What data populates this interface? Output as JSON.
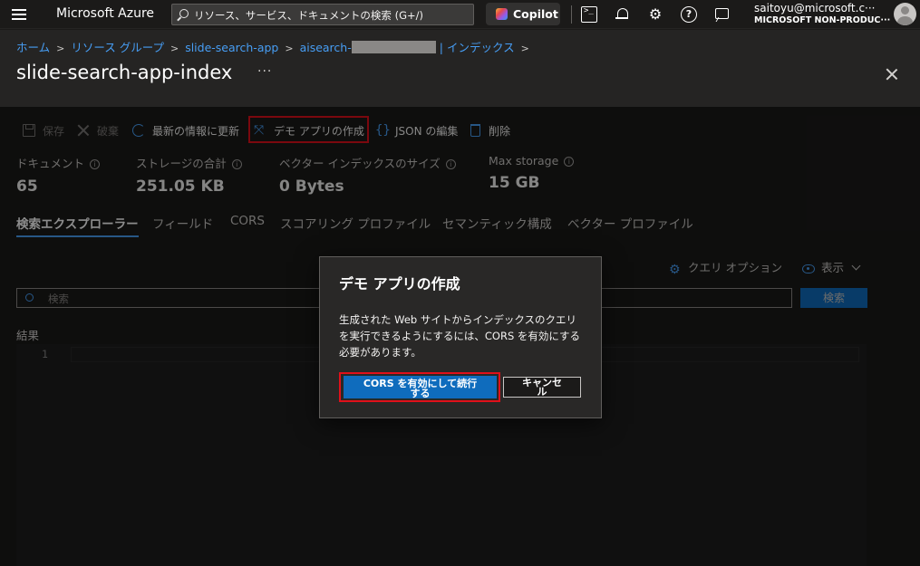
{
  "topbar": {
    "brand": "Microsoft Azure",
    "search_placeholder": "リソース、サービス、ドキュメントの検索 (G+/)",
    "copilot_label": "Copilot",
    "user_email": "saitoyu@microsoft.c···",
    "user_tenant": "MICROSOFT NON-PRODUC···"
  },
  "breadcrumb": {
    "home": "ホーム",
    "resource_groups": "リソース グループ",
    "app": "slide-search-app",
    "service_prefix": "aisearch-",
    "indexes": "インデックス"
  },
  "page": {
    "title": "slide-search-app-index",
    "more": "···"
  },
  "toolbar": {
    "save": "保存",
    "discard": "破棄",
    "refresh": "最新の情報に更新",
    "create_demo": "デモ アプリの作成",
    "edit_json": "JSON の編集",
    "delete": "削除"
  },
  "stats": [
    {
      "label": "ドキュメント",
      "value": "65"
    },
    {
      "label": "ストレージの合計",
      "value": "251.05 KB"
    },
    {
      "label": "ベクター インデックスのサイズ",
      "value": "0 Bytes"
    },
    {
      "label": "Max storage",
      "value": "15 GB"
    }
  ],
  "tabs": [
    "検索エクスプローラー",
    "フィールド",
    "CORS",
    "スコアリング プロファイル",
    "セマンティック構成",
    "ベクター プロファイル"
  ],
  "explorer": {
    "query_options": "クエリ オプション",
    "view": "表示",
    "search_placeholder": "検索",
    "search_button": "検索",
    "results_label": "結果",
    "line_number": "1"
  },
  "dialog": {
    "title": "デモ アプリの作成",
    "body": "生成された Web サイトからインデックスのクエリを実行できるようにするには、CORS を有効にする必要があります。",
    "primary_line1": "CORS を有効にして続行",
    "primary_line2": "する",
    "secondary_line1": "キャンセ",
    "secondary_line2": "ル"
  },
  "colors": {
    "accent": "#479ef5",
    "primary_button": "#0f6cbd",
    "highlight_box": "#e0101a"
  }
}
